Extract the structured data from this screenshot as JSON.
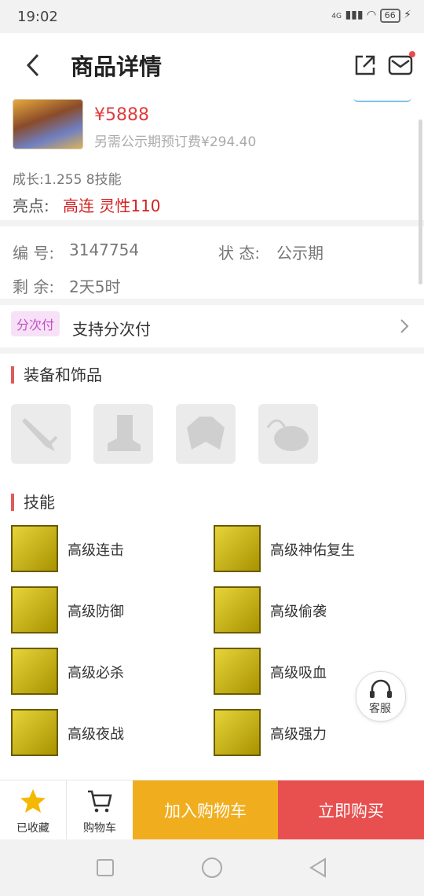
{
  "status_bar": {
    "time": "19:02",
    "network": "4G",
    "battery": "66"
  },
  "nav": {
    "title": "商品详情"
  },
  "product": {
    "price": "¥5888",
    "extra_fee": "另需公示期预订费¥294.40",
    "growth": "成长:1.255 8技能",
    "highlight_label": "亮点:",
    "highlight_value": "高连  灵性110"
  },
  "info": {
    "id_label": "编  号:",
    "id_value": "3147754",
    "status_label": "状  态:",
    "status_value": "公示期",
    "remaining_label": "剩  余:",
    "remaining_value": "2天5时"
  },
  "installment": {
    "badge": "分次付",
    "text": "支持分次付"
  },
  "equipment": {
    "title": "装备和饰品",
    "slots": [
      "weapon-icon",
      "boots-icon",
      "armor-icon",
      "accessory-icon"
    ]
  },
  "skills": {
    "title": "技能",
    "items": [
      "高级连击",
      "高级神佑复生",
      "高级防御",
      "高级偷袭",
      "高级必杀",
      "高级吸血",
      "高级夜战",
      "高级强力"
    ]
  },
  "service": {
    "label": "客服"
  },
  "bottom": {
    "favorite_label": "已收藏",
    "cart_label": "购物车",
    "add_cart": "加入购物车",
    "buy_now": "立即购买"
  },
  "colors": {
    "price": "#e03c3c",
    "add_cart": "#f0ae1f",
    "buy_now": "#e84f4f",
    "accent": "#e05a5a"
  }
}
